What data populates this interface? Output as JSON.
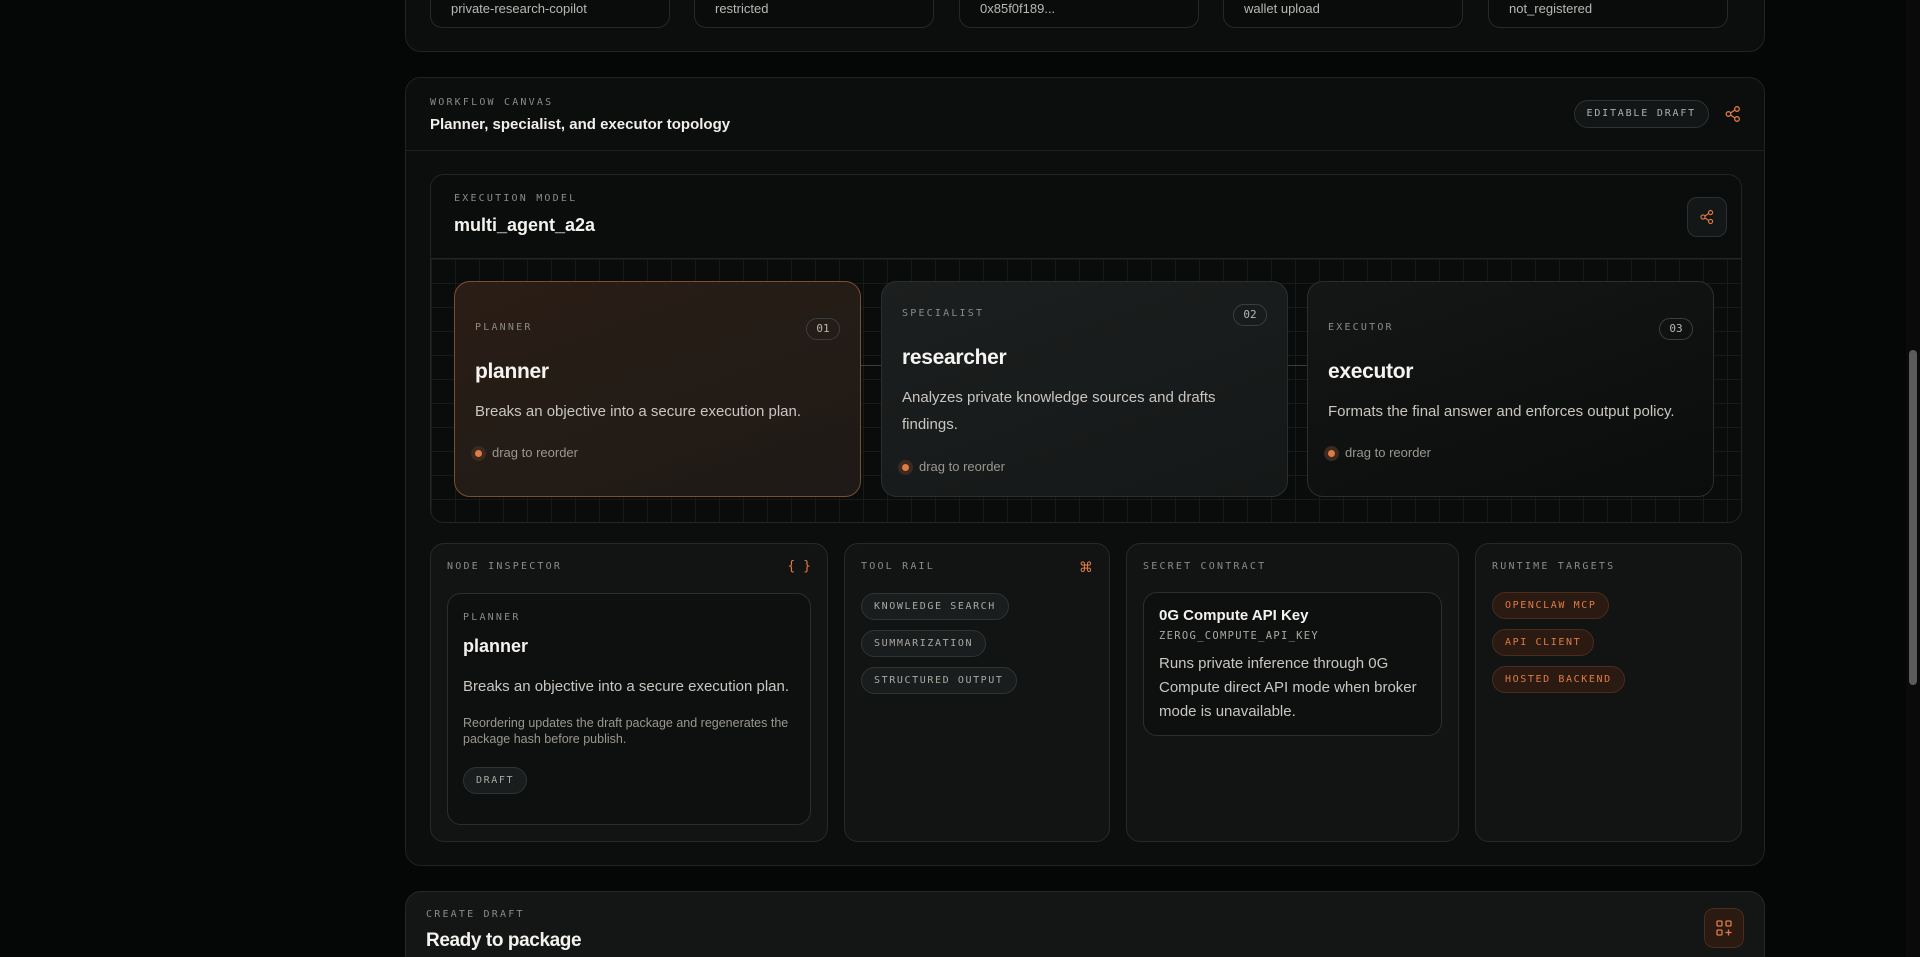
{
  "top_chips": [
    "private-research-copilot",
    "restricted",
    "0x85f0f189...",
    "wallet upload",
    "not_registered"
  ],
  "workflow": {
    "eyebrow": "WORKFLOW CANVAS",
    "title": "Planner, specialist, and executor topology",
    "status_pill": "EDITABLE DRAFT",
    "share_icon": "share-icon"
  },
  "execution": {
    "eyebrow": "EXECUTION MODEL",
    "title": "multi_agent_a2a",
    "nodes": [
      {
        "role": "PLANNER",
        "num": "01",
        "name": "planner",
        "desc": "Breaks an objective into a secure execution plan.",
        "drag": "drag to reorder"
      },
      {
        "role": "SPECIALIST",
        "num": "02",
        "name": "researcher",
        "desc": "Analyzes private knowledge sources and drafts findings.",
        "drag": "drag to reorder"
      },
      {
        "role": "EXECUTOR",
        "num": "03",
        "name": "executor",
        "desc": "Formats the final answer and enforces output policy.",
        "drag": "drag to reorder"
      }
    ]
  },
  "inspector": {
    "eyebrow": "NODE INSPECTOR",
    "icon_glyph": "{ }",
    "role": "PLANNER",
    "name": "planner",
    "desc": "Breaks an objective into a secure execution plan.",
    "note": "Reordering updates the draft package and regenerates the package hash before publish.",
    "badge": "DRAFT"
  },
  "tool_rail": {
    "eyebrow": "TOOL RAIL",
    "icon_glyph": "⌘",
    "tools": [
      "KNOWLEDGE SEARCH",
      "SUMMARIZATION",
      "STRUCTURED OUTPUT"
    ]
  },
  "secret_contract": {
    "eyebrow": "SECRET CONTRACT",
    "title": "0G Compute API Key",
    "env": "ZEROG_COMPUTE_API_KEY",
    "desc": "Runs private inference through 0G Compute direct API mode when broker mode is unavailable."
  },
  "runtime_targets": {
    "eyebrow": "RUNTIME TARGETS",
    "targets": [
      "OPENCLAW MCP",
      "API CLIENT",
      "HOSTED BACKEND"
    ]
  },
  "create_draft": {
    "eyebrow": "CREATE DRAFT",
    "title": "Ready to package"
  },
  "colors": {
    "accent": "#e07b43",
    "background": "#050606"
  }
}
